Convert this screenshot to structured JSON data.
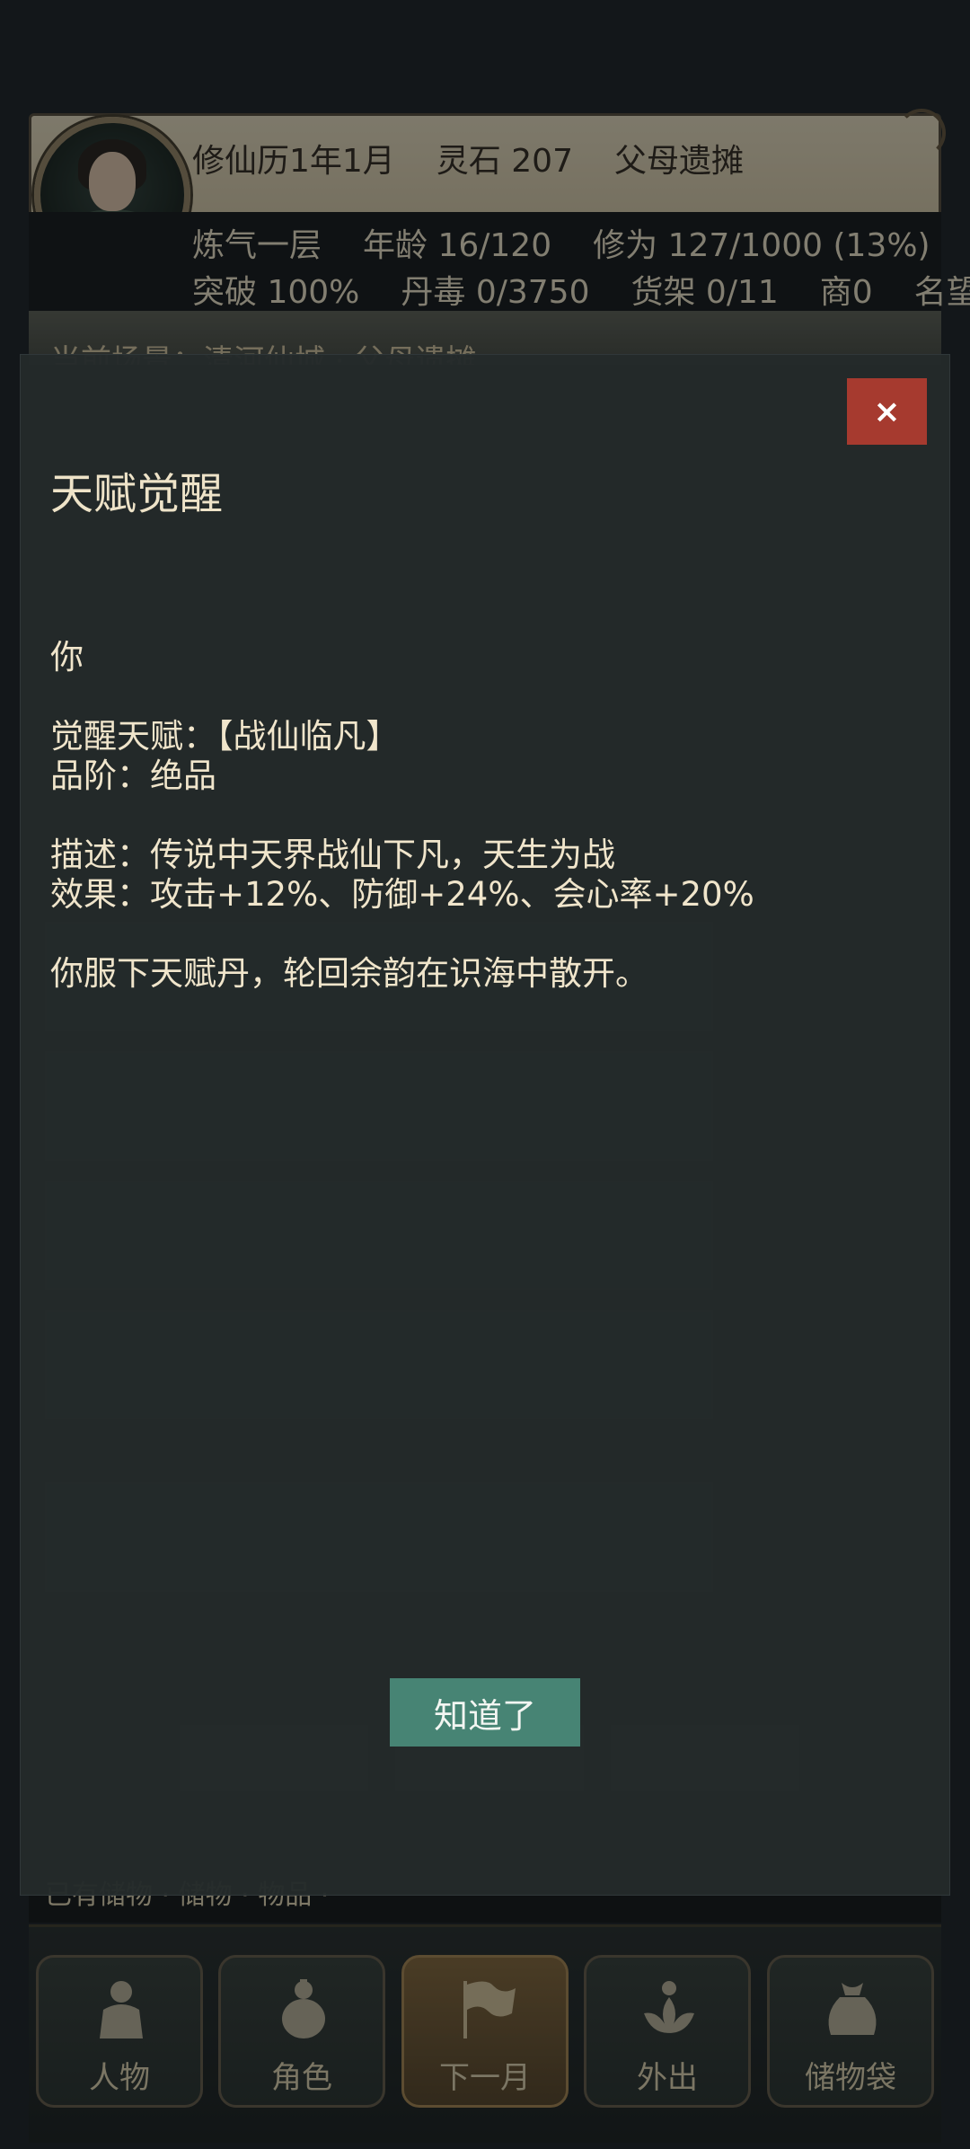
{
  "status": {
    "date": "修仙历1年1月",
    "spirit_stones": "灵石 207",
    "location_event": "父母遗摊",
    "realm": "炼气一层",
    "age": "年龄 16/120",
    "cultivation": "修为 127/1000 (13%)",
    "breakthrough": "突破 100%",
    "pill_toxicity": "丹毒 0/3750",
    "shelf": "货架 0/11",
    "merchant": "商0",
    "fame": "名望"
  },
  "scene": {
    "text": "当前场景：清河仙城 · 父母遗摊"
  },
  "modal": {
    "title": "天赋觉醒",
    "lines": [
      "你",
      "",
      "觉醒天赋：【战仙临凡】",
      "品阶：绝品",
      "",
      "描述：传说中天界战仙下凡，天生为战",
      "效果：攻击+12%、防御+24%、会心率+20%",
      "",
      "你服下天赋丹，轮回余韵在识海中散开。"
    ],
    "close_label": "×",
    "confirm_label": "知道了"
  },
  "footer_hint": "已有储物 · 储物 · 物品 ·",
  "nav": [
    {
      "label": "人物",
      "icon": "person-icon"
    },
    {
      "label": "角色",
      "icon": "gourd-icon"
    },
    {
      "label": "下一月",
      "icon": "flag-icon"
    },
    {
      "label": "外出",
      "icon": "lotus-icon"
    },
    {
      "label": "储物袋",
      "icon": "bag-icon"
    }
  ],
  "colors": {
    "close": "#a63a2f",
    "confirm": "#478474",
    "modal_bg": "#242a2a",
    "text": "#f0e5cb"
  }
}
